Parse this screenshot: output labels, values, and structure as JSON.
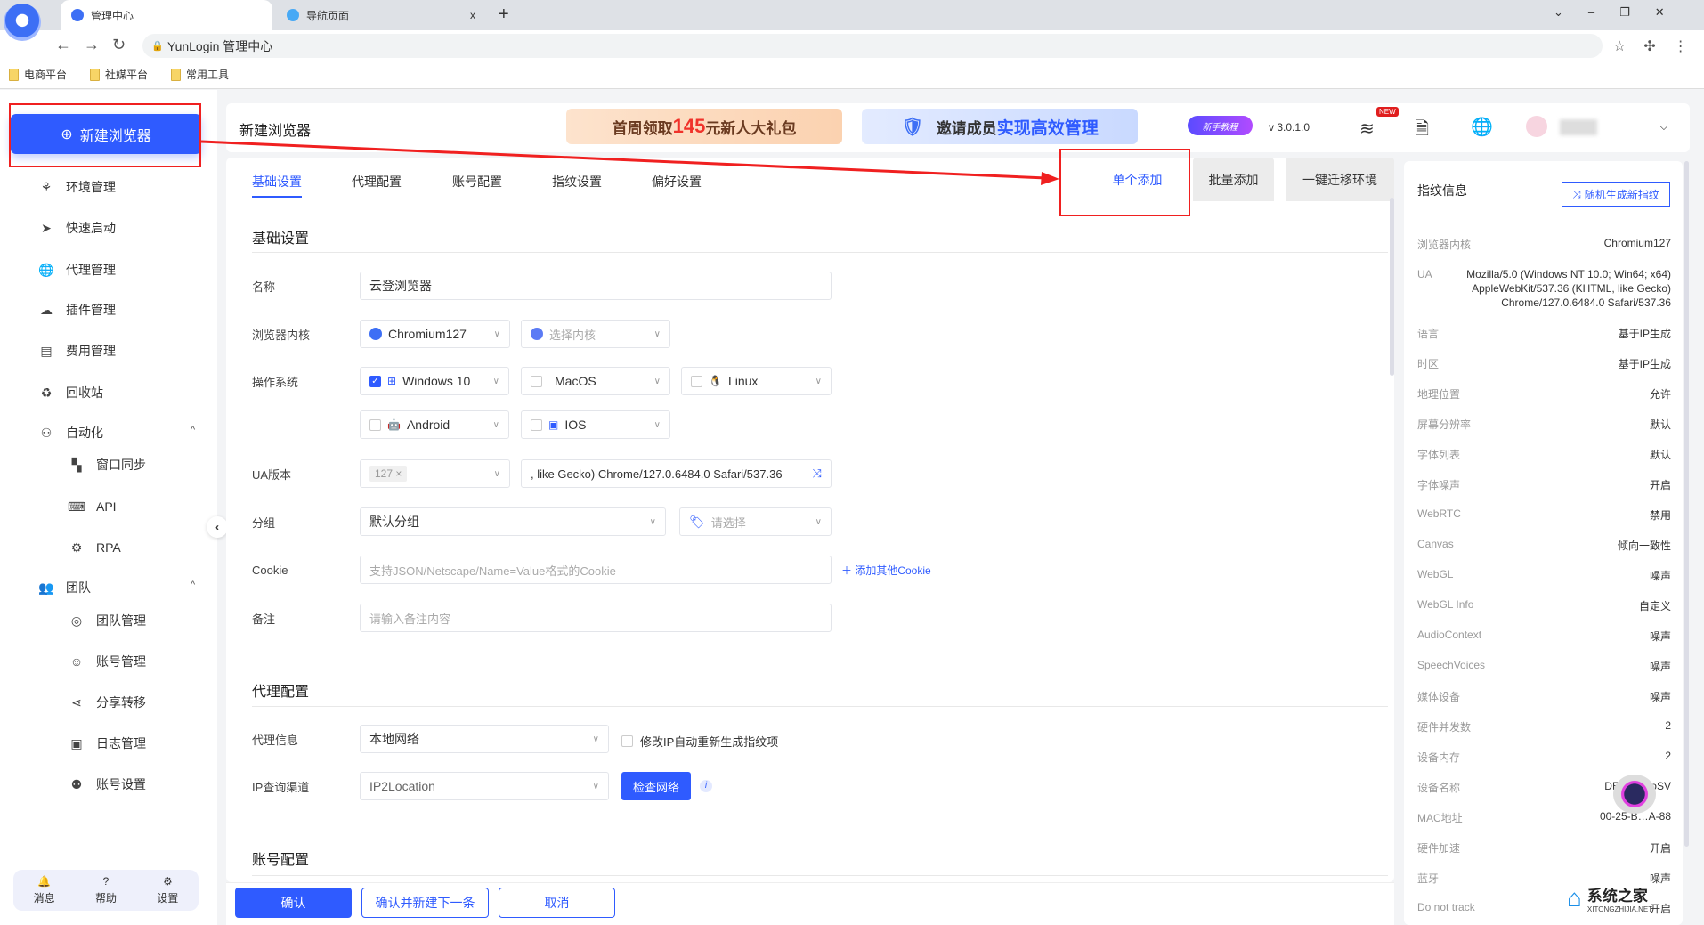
{
  "browser": {
    "tabs": [
      {
        "label": "管理中心"
      },
      {
        "label": "导航页面"
      }
    ],
    "new_tab": "+",
    "close": "x",
    "address": "YunLogin 管理中心",
    "bookmarks": [
      "电商平台",
      "社媒平台",
      "常用工具"
    ]
  },
  "sidebar": {
    "new_button": "新建浏览器",
    "items": [
      {
        "label": "环境管理",
        "icon": "⚘"
      },
      {
        "label": "快速启动",
        "icon": "➤"
      },
      {
        "label": "代理管理",
        "icon": "🌐"
      },
      {
        "label": "插件管理",
        "icon": "☁"
      },
      {
        "label": "费用管理",
        "icon": "▤"
      },
      {
        "label": "回收站",
        "icon": "♻"
      },
      {
        "label": "自动化",
        "icon": "⚇",
        "group": true
      },
      {
        "label": "窗口同步",
        "icon": "▚",
        "sub": true
      },
      {
        "label": "API",
        "icon": "⌨",
        "sub": true
      },
      {
        "label": "RPA",
        "icon": "⚙",
        "sub": true
      },
      {
        "label": "团队",
        "icon": "👥",
        "group": true
      },
      {
        "label": "团队管理",
        "icon": "◎",
        "sub": true
      },
      {
        "label": "账号管理",
        "icon": "☺",
        "sub": true
      },
      {
        "label": "分享转移",
        "icon": "⋖",
        "sub": true
      },
      {
        "label": "日志管理",
        "icon": "▣",
        "sub": true
      },
      {
        "label": "账号设置",
        "icon": "⚉",
        "sub": true
      }
    ],
    "bottom": [
      {
        "label": "消息",
        "icon": "🔔"
      },
      {
        "label": "帮助",
        "icon": "?"
      },
      {
        "label": "设置",
        "icon": "⚙"
      }
    ]
  },
  "header": {
    "title": "新建浏览器",
    "banner1": {
      "pre": "首周领取",
      "num": "145",
      "post": "元新人大礼包"
    },
    "banner2": {
      "pre": "邀请成员",
      "strong": "实现高效管理"
    },
    "tutorial": "新手教程",
    "version": "v 3.0.1.0",
    "new_badge": "NEW"
  },
  "form": {
    "tabs": [
      "基础设置",
      "代理配置",
      "账号配置",
      "指纹设置",
      "偏好设置"
    ],
    "mode_tabs": [
      "单个添加",
      "批量添加",
      "一键迁移环境"
    ],
    "basic": {
      "title": "基础设置",
      "name_label": "名称",
      "name_value": "云登浏览器",
      "kernel_label": "浏览器内核",
      "kernel_value": "Chromium127",
      "kernel2_placeholder": "选择内核",
      "os_label": "操作系统",
      "os": [
        {
          "label": "Windows 10",
          "checked": true
        },
        {
          "label": "MacOS"
        },
        {
          "label": "Linux"
        },
        {
          "label": "Android"
        },
        {
          "label": "IOS"
        }
      ],
      "ua_label": "UA版本",
      "ua_tag": "127",
      "ua_value": ", like Gecko) Chrome/127.0.6484.0 Safari/537.36",
      "group_label": "分组",
      "group_value": "默认分组",
      "tag_placeholder": "请选择",
      "cookie_label": "Cookie",
      "cookie_placeholder": "支持JSON/Netscape/Name=Value格式的Cookie",
      "add_cookie": "添加其他Cookie",
      "remark_label": "备注",
      "remark_placeholder": "请输入备注内容"
    },
    "proxy": {
      "title": "代理配置",
      "info_label": "代理信息",
      "info_value": "本地网络",
      "regen_label": "修改IP自动重新生成指纹项",
      "channel_label": "IP查询渠道",
      "channel_value": "IP2Location",
      "check_button": "检查网络"
    },
    "account": {
      "title": "账号配置"
    },
    "footer": {
      "confirm": "确认",
      "confirm_next": "确认并新建下一条",
      "cancel": "取消"
    }
  },
  "fingerprint": {
    "title": "指纹信息",
    "random_button": "随机生成新指纹",
    "kernel_label": "浏览器内核",
    "kernel_value": "Chromium127",
    "ua_label": "UA",
    "ua_value": "Mozilla/5.0 (Windows NT 10.0; Win64; x64) AppleWebKit/537.36 (KHTML, like Gecko) Chrome/127.0.6484.0 Safari/537.36",
    "rows": [
      {
        "l": "语言",
        "v": "基于IP生成"
      },
      {
        "l": "时区",
        "v": "基于IP生成"
      },
      {
        "l": "地理位置",
        "v": "允许"
      },
      {
        "l": "屏幕分辨率",
        "v": "默认"
      },
      {
        "l": "字体列表",
        "v": "默认"
      },
      {
        "l": "字体噪声",
        "v": "开启"
      },
      {
        "l": "WebRTC",
        "v": "禁用"
      },
      {
        "l": "Canvas",
        "v": "倾向一致性"
      },
      {
        "l": "WebGL",
        "v": "噪声"
      },
      {
        "l": "WebGL Info",
        "v": "自定义"
      },
      {
        "l": "AudioContext",
        "v": "噪声"
      },
      {
        "l": "SpeechVoices",
        "v": "噪声"
      },
      {
        "l": "媒体设备",
        "v": "噪声"
      },
      {
        "l": "硬件并发数",
        "v": "2"
      },
      {
        "l": "设备内存",
        "v": "2"
      },
      {
        "l": "设备名称",
        "v": "DESKT…oSV"
      },
      {
        "l": "MAC地址",
        "v": "00-25-B…A-88"
      },
      {
        "l": "硬件加速",
        "v": "开启"
      },
      {
        "l": "蓝牙",
        "v": "噪声"
      },
      {
        "l": "Do not track",
        "v": "开启"
      }
    ]
  },
  "watermark": {
    "text": "系统之家",
    "sub": "XITONGZHIJIA.NET"
  },
  "colors": {
    "accent": "#2f5bff",
    "annotation": "#f02020"
  }
}
